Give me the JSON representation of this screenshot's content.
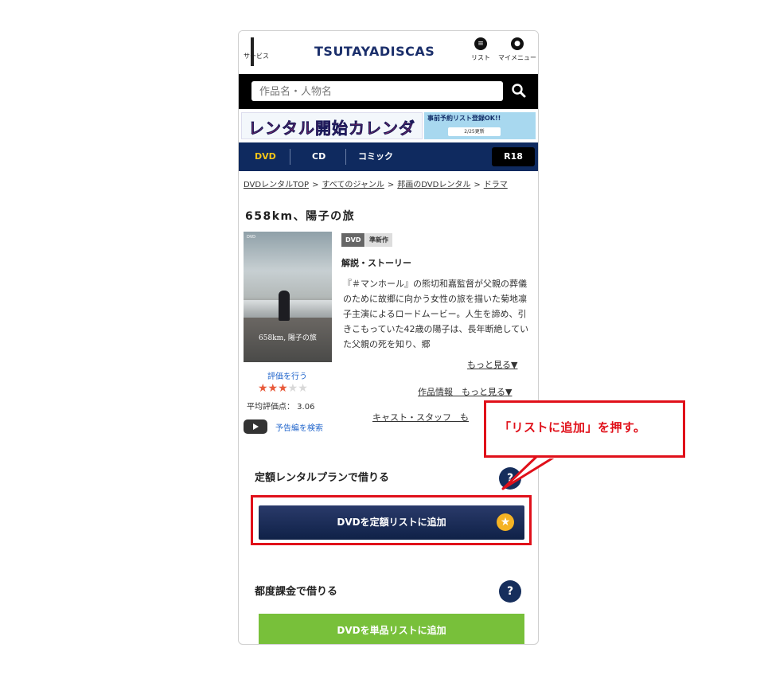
{
  "header": {
    "service_label": "サービス",
    "logo_text": "TSUTAYADISCAS",
    "list_label": "リスト",
    "mymenu_label": "マイメニュー"
  },
  "search": {
    "placeholder": "作品名・人物名"
  },
  "banner": {
    "title": "レンタル開始カレンダー",
    "sub1": "事前予約リスト登録OK!!",
    "sub2": "2/25更新"
  },
  "tabs": {
    "dvd": "DVD",
    "cd": "CD",
    "comic": "コミック",
    "r18": "R18"
  },
  "breadcrumb": {
    "items": [
      "DVDレンタルTOP",
      "すべてのジャンル",
      "邦画のDVDレンタル",
      "ドラマ"
    ],
    "sep": ">"
  },
  "work": {
    "title": "658km、陽子の旅",
    "poster_text": "658km, 陽子の旅",
    "poster_label": "DVD",
    "badge_dvd": "DVD",
    "badge_new": "準新作",
    "story_heading": "解説・ストーリー",
    "story_text": "『＃マンホール』の熊切和嘉監督が父親の葬儀のために故郷に向かう女性の旅を描いた菊地凛子主演によるロードムービー。人生を諦め、引きこもっていた42歳の陽子は、長年断絶していた父親の死を知り、郷",
    "more_story": "もっと見る▼",
    "more_info": "作品情報　もっと見る▼",
    "more_cast": "キャスト・スタッフ　も"
  },
  "rating": {
    "rate_link": "評価を行う",
    "stars_on": "★★★",
    "stars_off": "★★",
    "average": "平均評価点： 3.06",
    "stars_value": 3.06,
    "trailer": "予告編を検索"
  },
  "plans": {
    "fixed_heading": "定額レンタルプランで借りる",
    "fixed_button": "DVDを定額リストに追加",
    "single_heading": "都度課金で借りる",
    "single_button": "DVDを単品リストに追加",
    "help": "?"
  },
  "annotation": {
    "callout": "「リストに追加」を押す。",
    "color": "#e0101a"
  }
}
